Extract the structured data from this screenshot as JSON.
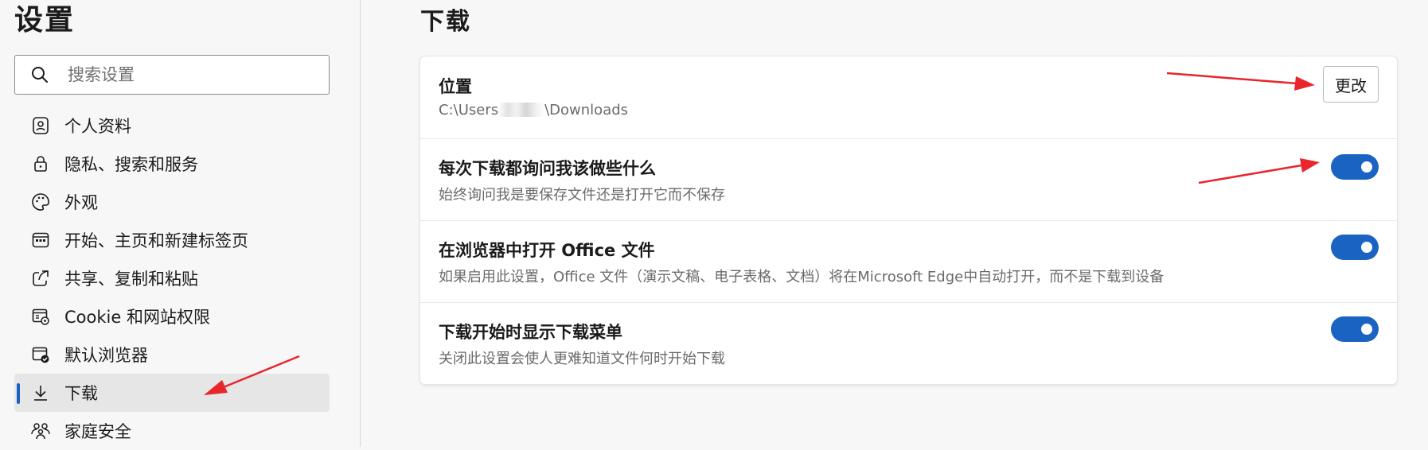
{
  "sidebar": {
    "title": "设置",
    "search": {
      "placeholder": "搜索设置",
      "value": ""
    },
    "items": [
      {
        "label": "个人资料",
        "icon": "profile-icon",
        "active": false
      },
      {
        "label": "隐私、搜索和服务",
        "icon": "lock-icon",
        "active": false
      },
      {
        "label": "外观",
        "icon": "palette-icon",
        "active": false
      },
      {
        "label": "开始、主页和新建标签页",
        "icon": "start-page-icon",
        "active": false
      },
      {
        "label": "共享、复制和粘贴",
        "icon": "share-icon",
        "active": false
      },
      {
        "label": "Cookie 和网站权限",
        "icon": "site-permissions-icon",
        "active": false
      },
      {
        "label": "默认浏览器",
        "icon": "default-browser-icon",
        "active": false
      },
      {
        "label": "下载",
        "icon": "download-icon",
        "active": true
      },
      {
        "label": "家庭安全",
        "icon": "family-icon",
        "active": false
      }
    ]
  },
  "main": {
    "title": "下载",
    "location": {
      "title": "位置",
      "path_prefix": "C:\\Users",
      "path_suffix": "\\Downloads",
      "change_label": "更改"
    },
    "settings": [
      {
        "title": "每次下载都询问我该做些什么",
        "description": "始终询问我是要保存文件还是打开它而不保存",
        "enabled": true
      },
      {
        "title": "在浏览器中打开 Office 文件",
        "description": "如果启用此设置，Office 文件（演示文稿、电子表格、文档）将在Microsoft Edge中自动打开，而不是下载到设备",
        "enabled": true
      },
      {
        "title": "下载开始时显示下载菜单",
        "description": "关闭此设置会使人更难知道文件何时开始下载",
        "enabled": true
      }
    ]
  },
  "colors": {
    "accent": "#1a63c2",
    "annotation_arrow": "#e8262b"
  }
}
